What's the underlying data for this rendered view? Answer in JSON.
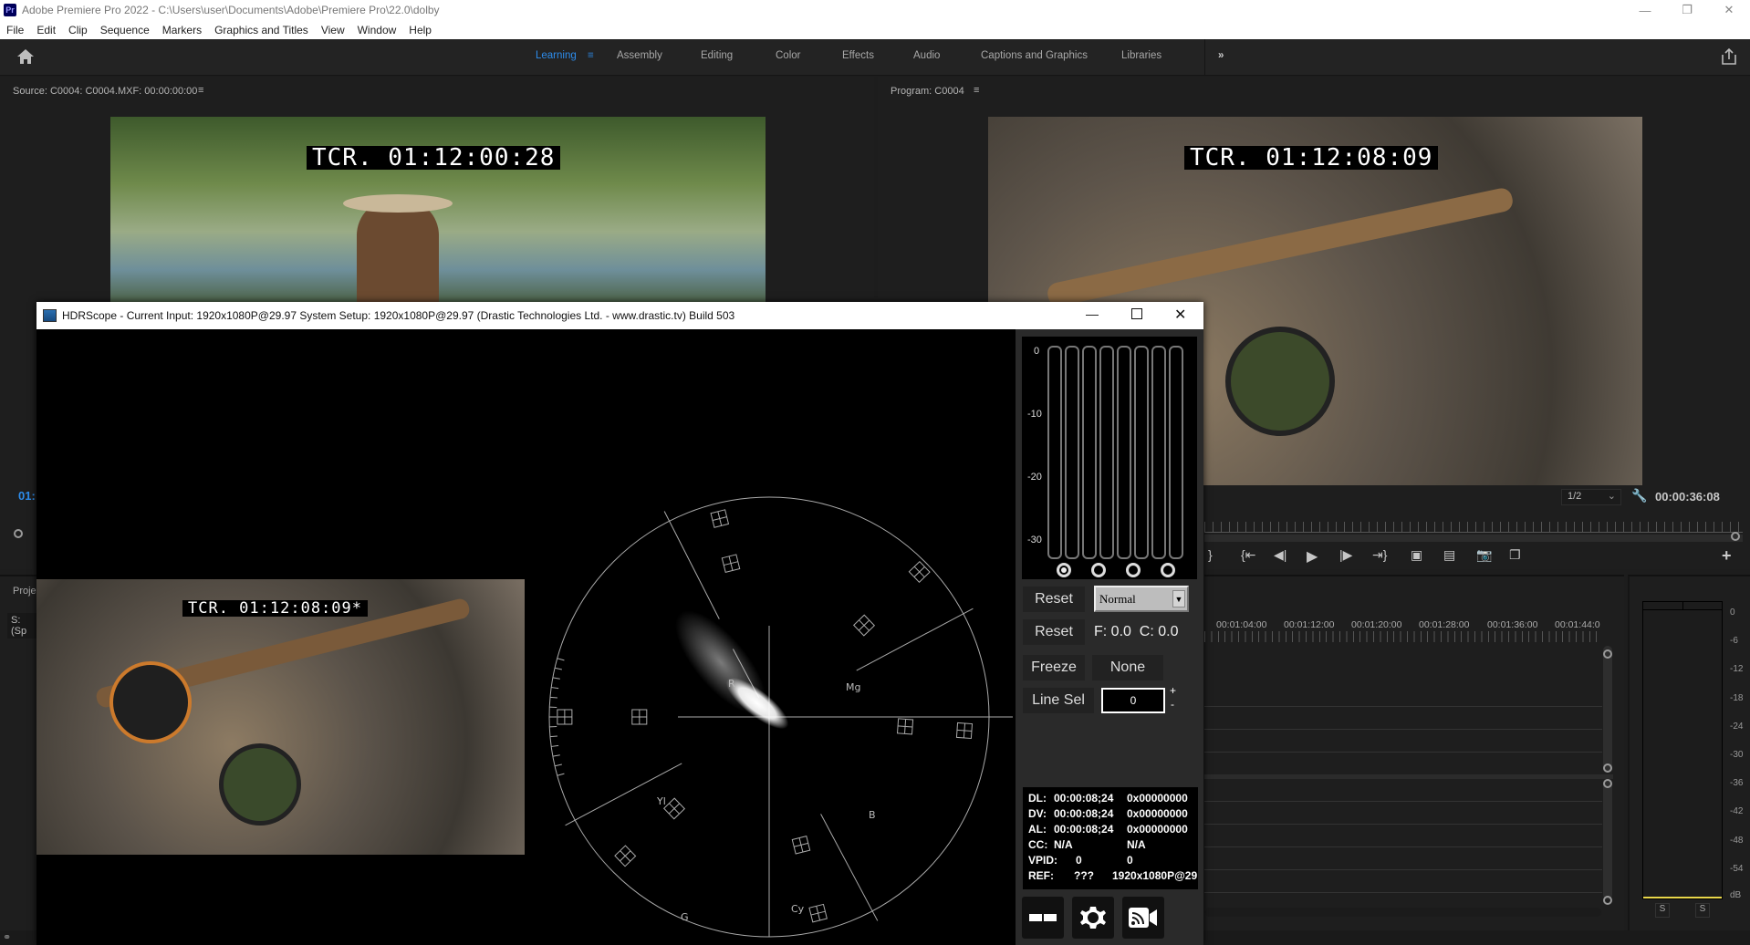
{
  "app": {
    "title": "Adobe Premiere Pro 2022 - C:\\Users\\user\\Documents\\Adobe\\Premiere Pro\\22.0\\dolby",
    "logo": "Pr"
  },
  "menu": [
    "File",
    "Edit",
    "Clip",
    "Sequence",
    "Markers",
    "Graphics and Titles",
    "View",
    "Window",
    "Help"
  ],
  "workspaces": {
    "tabs": [
      "Learning",
      "Assembly",
      "Editing",
      "Color",
      "Effects",
      "Audio",
      "Captions and Graphics",
      "Libraries"
    ],
    "active": "Learning",
    "overflow": "»"
  },
  "source_monitor": {
    "title": "Source: C0004: C0004.MXF: 00:00:00:00",
    "tcr": "TCR. 01:12:00:28"
  },
  "program_monitor": {
    "title": "Program: C0004",
    "tcr": "TCR. 01:12:08:09",
    "zoom": "1/2",
    "timecode": "00:00:36:08"
  },
  "left_partial": {
    "timecode": "01:",
    "project_label": "Proje",
    "search_label": "S: (Sp"
  },
  "hdrscope": {
    "title": "HDRScope -  Current Input: 1920x1080P@29.97   System Setup: 1920x1080P@29.97     (Drastic Technologies Ltd. - www.drastic.tv) Build 503",
    "thumbnail_tcr": "TCR. 01:12:08:09*",
    "vectorscope_labels": {
      "R": "R",
      "Mg": "Mg",
      "B": "B",
      "Cy": "Cy",
      "G": "G",
      "Yl": "Yl"
    },
    "meter_scale": [
      "0",
      "-10",
      "-20",
      "-30"
    ],
    "meter_channels": 8,
    "meter_selected_radio": 0,
    "reset1": "Reset",
    "mode_select": "Normal",
    "reset2": "Reset",
    "fc_readout": "F: 0.0  C: 0.0",
    "freeze": "Freeze",
    "none": "None",
    "line_sel": "Line Sel",
    "line_value": "0",
    "plus": "+",
    "minus": "-",
    "readout": [
      {
        "k": "DL:",
        "v1": "00:00:08;24",
        "v2": "0x00000000"
      },
      {
        "k": "DV:",
        "v1": "00:00:08;24",
        "v2": "0x00000000"
      },
      {
        "k": "AL:",
        "v1": "00:00:08;24",
        "v2": "0x00000000"
      },
      {
        "k": "CC:",
        "v1": "N/A",
        "v2": "N/A"
      },
      {
        "k": "VPID:",
        "v1": "0",
        "v2": "0"
      },
      {
        "k": "REF:",
        "v1": "???",
        "v2": "1920x1080P@29"
      }
    ]
  },
  "timeline": {
    "ruler": [
      "00:01:04:00",
      "00:01:12:00",
      "00:01:20:00",
      "00:01:28:00",
      "00:01:36:00",
      "00:01:44:0"
    ]
  },
  "audio_meter": {
    "scale": [
      "0",
      "-6",
      "-12",
      "-18",
      "-24",
      "-30",
      "-36",
      "-42",
      "-48",
      "-54",
      "dB"
    ],
    "solo": [
      "S",
      "S"
    ]
  },
  "colors": {
    "accent": "#2d8ceb",
    "panel": "#1e1e1e",
    "meter_level": "#e8d64a"
  }
}
